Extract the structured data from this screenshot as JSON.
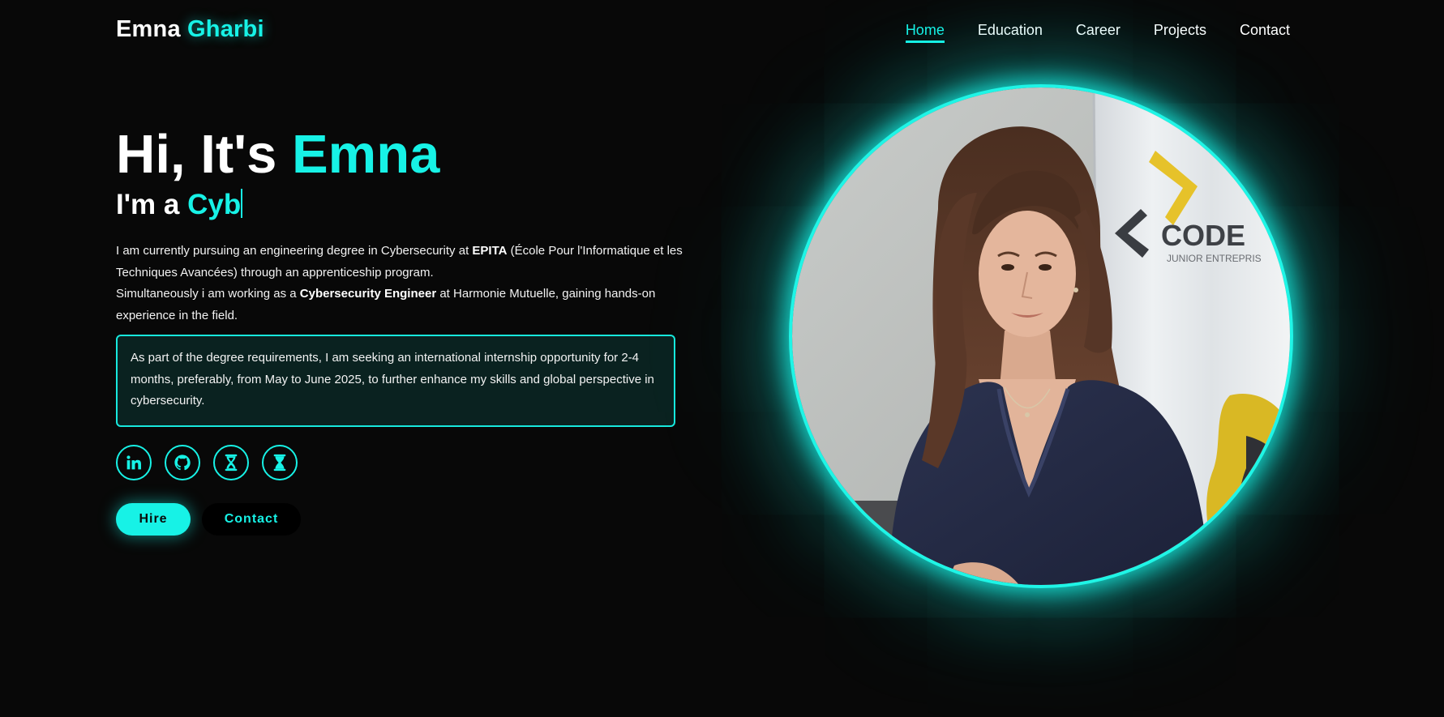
{
  "header": {
    "logo_first": "Emna",
    "logo_last": "Gharbi",
    "nav": [
      {
        "label": "Home",
        "active": true
      },
      {
        "label": "Education"
      },
      {
        "label": "Career"
      },
      {
        "label": "Projects"
      },
      {
        "label": "Contact"
      }
    ]
  },
  "hero": {
    "title_prefix": "Hi, It's",
    "title_name": "Emna",
    "sub_prefix": "I'm a",
    "sub_typed": "Cyb",
    "bio_1a": "I am currently pursuing an engineering degree in Cybersecurity at ",
    "bio_1b": "EPITA",
    "bio_1c": " (École Pour l'Informatique et les Techniques Avancées) through an apprenticeship program.",
    "bio_2a": "Simultaneously i am working as a ",
    "bio_2b": "Cybersecurity Engineer",
    "bio_2c": " at Harmonie Mutuelle, gaining hands-on experience in the field.",
    "notice": "As part of the degree requirements, I am seeking an international internship opportunity for 2-4 months, preferably, from May to June 2025, to further enhance my skills and global perspective in cybersecurity."
  },
  "socials": [
    {
      "icon": "linkedin-icon"
    },
    {
      "icon": "github-icon"
    },
    {
      "icon": "hourglass-icon"
    },
    {
      "icon": "hourglass-icon"
    }
  ],
  "buttons": {
    "hire": "Hire",
    "contact": "Contact"
  },
  "photo": {
    "banner_text": "CODE",
    "banner_sub": "JUNIOR ENTREPRIS"
  },
  "colors": {
    "accent": "#17f2e6",
    "background": "#080808"
  }
}
